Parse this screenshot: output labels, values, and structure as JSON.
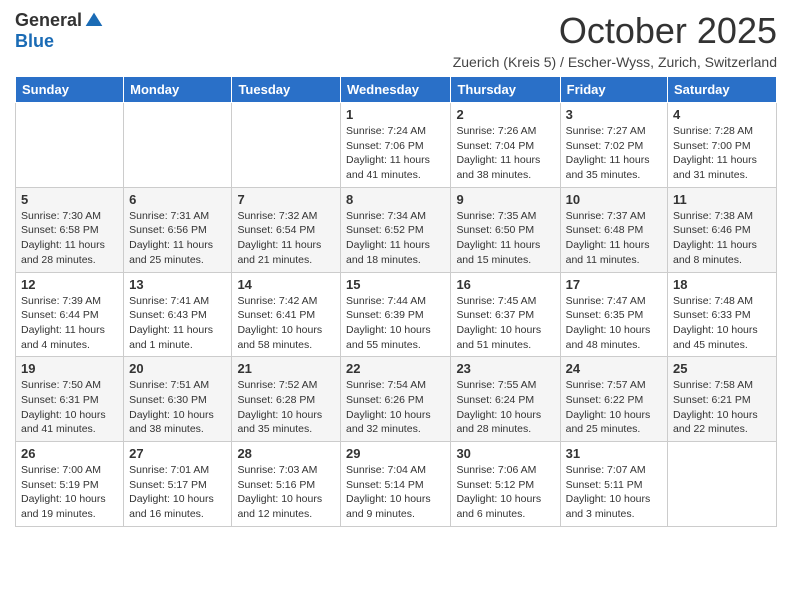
{
  "logo": {
    "general": "General",
    "blue": "Blue"
  },
  "title": "October 2025",
  "subtitle": "Zuerich (Kreis 5) / Escher-Wyss, Zurich, Switzerland",
  "days_of_week": [
    "Sunday",
    "Monday",
    "Tuesday",
    "Wednesday",
    "Thursday",
    "Friday",
    "Saturday"
  ],
  "weeks": [
    [
      {
        "day": "",
        "info": ""
      },
      {
        "day": "",
        "info": ""
      },
      {
        "day": "",
        "info": ""
      },
      {
        "day": "1",
        "info": "Sunrise: 7:24 AM\nSunset: 7:06 PM\nDaylight: 11 hours and 41 minutes."
      },
      {
        "day": "2",
        "info": "Sunrise: 7:26 AM\nSunset: 7:04 PM\nDaylight: 11 hours and 38 minutes."
      },
      {
        "day": "3",
        "info": "Sunrise: 7:27 AM\nSunset: 7:02 PM\nDaylight: 11 hours and 35 minutes."
      },
      {
        "day": "4",
        "info": "Sunrise: 7:28 AM\nSunset: 7:00 PM\nDaylight: 11 hours and 31 minutes."
      }
    ],
    [
      {
        "day": "5",
        "info": "Sunrise: 7:30 AM\nSunset: 6:58 PM\nDaylight: 11 hours and 28 minutes."
      },
      {
        "day": "6",
        "info": "Sunrise: 7:31 AM\nSunset: 6:56 PM\nDaylight: 11 hours and 25 minutes."
      },
      {
        "day": "7",
        "info": "Sunrise: 7:32 AM\nSunset: 6:54 PM\nDaylight: 11 hours and 21 minutes."
      },
      {
        "day": "8",
        "info": "Sunrise: 7:34 AM\nSunset: 6:52 PM\nDaylight: 11 hours and 18 minutes."
      },
      {
        "day": "9",
        "info": "Sunrise: 7:35 AM\nSunset: 6:50 PM\nDaylight: 11 hours and 15 minutes."
      },
      {
        "day": "10",
        "info": "Sunrise: 7:37 AM\nSunset: 6:48 PM\nDaylight: 11 hours and 11 minutes."
      },
      {
        "day": "11",
        "info": "Sunrise: 7:38 AM\nSunset: 6:46 PM\nDaylight: 11 hours and 8 minutes."
      }
    ],
    [
      {
        "day": "12",
        "info": "Sunrise: 7:39 AM\nSunset: 6:44 PM\nDaylight: 11 hours and 4 minutes."
      },
      {
        "day": "13",
        "info": "Sunrise: 7:41 AM\nSunset: 6:43 PM\nDaylight: 11 hours and 1 minute."
      },
      {
        "day": "14",
        "info": "Sunrise: 7:42 AM\nSunset: 6:41 PM\nDaylight: 10 hours and 58 minutes."
      },
      {
        "day": "15",
        "info": "Sunrise: 7:44 AM\nSunset: 6:39 PM\nDaylight: 10 hours and 55 minutes."
      },
      {
        "day": "16",
        "info": "Sunrise: 7:45 AM\nSunset: 6:37 PM\nDaylight: 10 hours and 51 minutes."
      },
      {
        "day": "17",
        "info": "Sunrise: 7:47 AM\nSunset: 6:35 PM\nDaylight: 10 hours and 48 minutes."
      },
      {
        "day": "18",
        "info": "Sunrise: 7:48 AM\nSunset: 6:33 PM\nDaylight: 10 hours and 45 minutes."
      }
    ],
    [
      {
        "day": "19",
        "info": "Sunrise: 7:50 AM\nSunset: 6:31 PM\nDaylight: 10 hours and 41 minutes."
      },
      {
        "day": "20",
        "info": "Sunrise: 7:51 AM\nSunset: 6:30 PM\nDaylight: 10 hours and 38 minutes."
      },
      {
        "day": "21",
        "info": "Sunrise: 7:52 AM\nSunset: 6:28 PM\nDaylight: 10 hours and 35 minutes."
      },
      {
        "day": "22",
        "info": "Sunrise: 7:54 AM\nSunset: 6:26 PM\nDaylight: 10 hours and 32 minutes."
      },
      {
        "day": "23",
        "info": "Sunrise: 7:55 AM\nSunset: 6:24 PM\nDaylight: 10 hours and 28 minutes."
      },
      {
        "day": "24",
        "info": "Sunrise: 7:57 AM\nSunset: 6:22 PM\nDaylight: 10 hours and 25 minutes."
      },
      {
        "day": "25",
        "info": "Sunrise: 7:58 AM\nSunset: 6:21 PM\nDaylight: 10 hours and 22 minutes."
      }
    ],
    [
      {
        "day": "26",
        "info": "Sunrise: 7:00 AM\nSunset: 5:19 PM\nDaylight: 10 hours and 19 minutes."
      },
      {
        "day": "27",
        "info": "Sunrise: 7:01 AM\nSunset: 5:17 PM\nDaylight: 10 hours and 16 minutes."
      },
      {
        "day": "28",
        "info": "Sunrise: 7:03 AM\nSunset: 5:16 PM\nDaylight: 10 hours and 12 minutes."
      },
      {
        "day": "29",
        "info": "Sunrise: 7:04 AM\nSunset: 5:14 PM\nDaylight: 10 hours and 9 minutes."
      },
      {
        "day": "30",
        "info": "Sunrise: 7:06 AM\nSunset: 5:12 PM\nDaylight: 10 hours and 6 minutes."
      },
      {
        "day": "31",
        "info": "Sunrise: 7:07 AM\nSunset: 5:11 PM\nDaylight: 10 hours and 3 minutes."
      },
      {
        "day": "",
        "info": ""
      }
    ]
  ]
}
